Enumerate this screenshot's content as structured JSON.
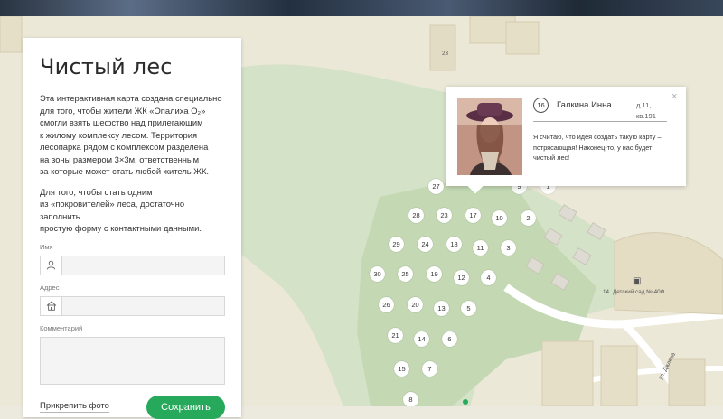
{
  "panel": {
    "title": "Чистый лес",
    "intro_lines": [
      "Эта интерактивная карта создана специально",
      "для того, чтобы жители ЖК «Опалиха O₂»",
      "смогли взять шефство над прилегающим",
      "к жилому комплексу лесом. Территория",
      "лесопарка рядом с комплексом разделена",
      "на зоны размером 3×3м, ответственным",
      "за которые может стать любой житель ЖК."
    ],
    "call_lines": [
      "Для того, чтобы стать одним",
      "из «покровителей» леса, достаточно заполнить",
      "простую форму с контактными данными."
    ],
    "name_label": "Имя",
    "name_value": "",
    "address_label": "Адрес",
    "address_value": "",
    "comment_label": "Комментарий",
    "comment_value": "",
    "attach_label": "Прикрепить фото",
    "save_label": "Сохранить"
  },
  "popup": {
    "plot_number": "16",
    "name": "Галкина Инна",
    "address_line1": "д.11,",
    "address_line2": "кв.191",
    "quote": "Я считаю, что идея создать такую карту – потрясающая! Наконец-то, у нас будет чистый лес!",
    "close_symbol": "×"
  },
  "map": {
    "building_number_23": "23",
    "building_number_14": "14",
    "kindergarten_label": "Детский сад № 40Ф",
    "street_label": "ул. Джлева",
    "plots": [
      "27",
      "28",
      "23",
      "17",
      "10",
      "2",
      "29",
      "24",
      "18",
      "11",
      "3",
      "30",
      "25",
      "19",
      "12",
      "4",
      "26",
      "20",
      "13",
      "5",
      "21",
      "14",
      "6",
      "15",
      "7",
      "8",
      "9",
      "1"
    ]
  },
  "colors": {
    "accent_green": "#26a95a",
    "forest_green": "#c9dcbd",
    "zone_green": "#b9cfab",
    "map_base": "#ebe8d8"
  }
}
